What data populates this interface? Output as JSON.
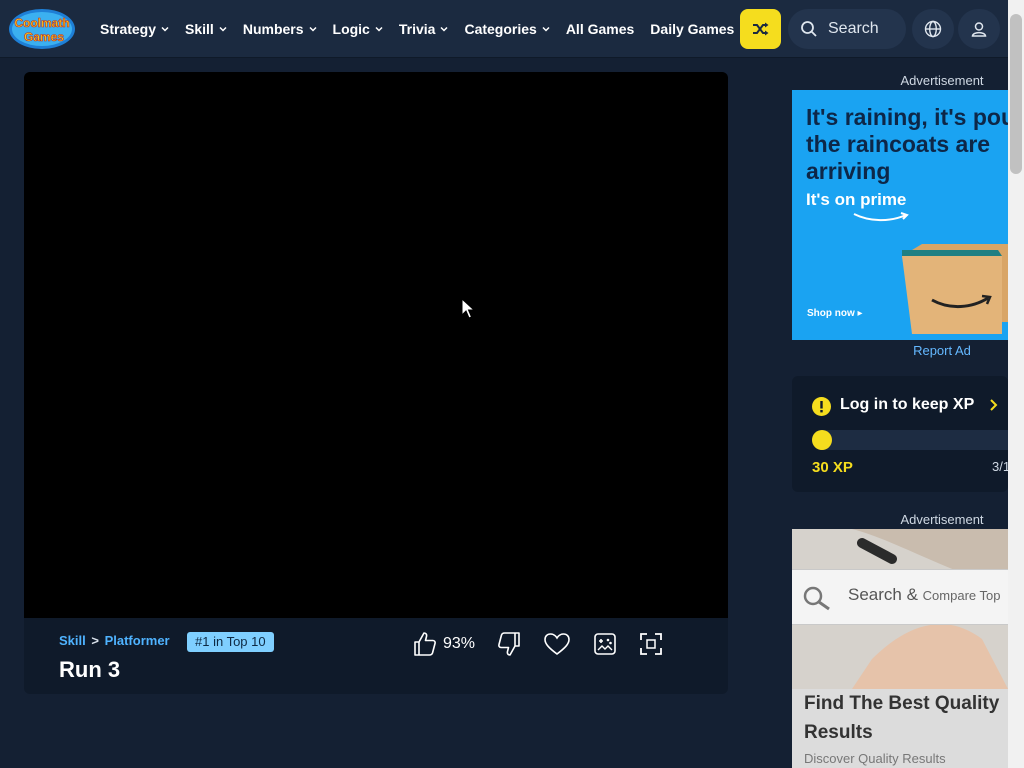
{
  "header": {
    "logo_line1": "Coolmath",
    "logo_line2": "Games",
    "nav": [
      {
        "label": "Strategy",
        "dropdown": true
      },
      {
        "label": "Skill",
        "dropdown": true
      },
      {
        "label": "Numbers",
        "dropdown": true
      },
      {
        "label": "Logic",
        "dropdown": true
      },
      {
        "label": "Trivia",
        "dropdown": true
      },
      {
        "label": "Categories",
        "dropdown": true
      },
      {
        "label": "All Games",
        "dropdown": false
      },
      {
        "label": "Daily Games",
        "dropdown": false
      }
    ],
    "search_placeholder": "Search",
    "icons": {
      "shuffle": "shuffle-icon",
      "search": "search-icon",
      "language": "globe-icon",
      "account": "user-icon"
    }
  },
  "game": {
    "breadcrumb_category": "Skill",
    "breadcrumb_separator": ">",
    "breadcrumb_subcategory": "Platformer",
    "rank_badge": "#1 in Top 10",
    "title": "Run 3",
    "like_percent": "93%"
  },
  "sidebar": {
    "ad_label_top": "Advertisement",
    "ad1": {
      "headline": "It's raining, it's pouring, the raincoats are arriving",
      "prime": "It's on prime",
      "cta": "Shop now ▸"
    },
    "report_ad": "Report Ad",
    "xp": {
      "title": "Log in to keep XP",
      "amount": "30 XP",
      "progress_fraction": 0.05,
      "level": "3/1"
    },
    "ad_label_bottom": "Advertisement",
    "ad2": {
      "search_text": "Search &",
      "search_small": "Compare Top",
      "headline": "Find The Best Quality Results",
      "sub": "Discover Quality Results"
    }
  },
  "colors": {
    "bg": "#142033",
    "nav": "#1b2a40",
    "accent": "#f5dd1e",
    "link": "#4fb3ff"
  }
}
